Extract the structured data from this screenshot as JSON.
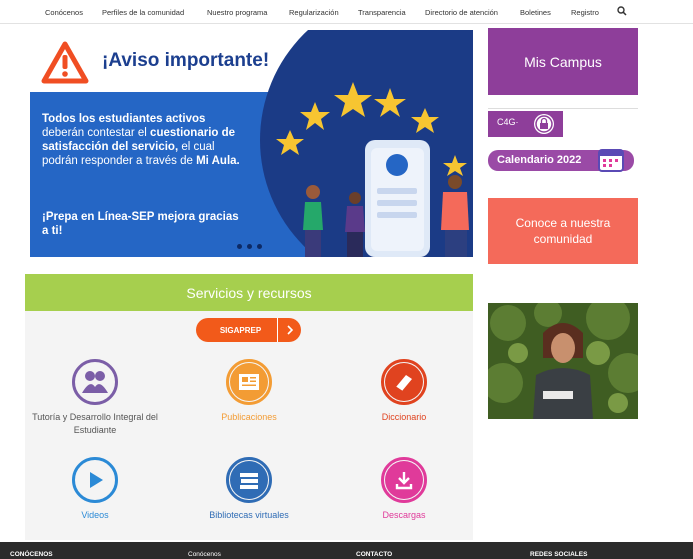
{
  "nav": {
    "items": [
      {
        "label": "Conócenos"
      },
      {
        "label": "Perfiles de la comunidad"
      },
      {
        "label": "Nuestro programa"
      },
      {
        "label": "Regularización"
      },
      {
        "label": "Transparencia"
      },
      {
        "label": "Directorio de atención"
      },
      {
        "label": "Boletines"
      },
      {
        "label": "Registro"
      }
    ],
    "search_icon": "search-icon"
  },
  "hero": {
    "title": "¡Aviso importante!",
    "msg_bold1": "Todos los estudiantes activos",
    "msg_normal1": " deberán contestar el ",
    "msg_bold2": "cuestionario de satisfacción del servicio,",
    "msg_normal2": " el cual podrán responder a través de ",
    "msg_bold3": "Mi Aula.",
    "msg2": "¡Prepa en Línea-SEP mejora gracias a ti!",
    "colors": {
      "dark": "#1c3f8f",
      "blue": "#2566c5",
      "warning": "#f04e23"
    }
  },
  "services": {
    "heading": "Servicios y recursos",
    "sigaprep_label": "SIGAPREP",
    "items": [
      {
        "label": "Tutoría y Desarrollo Integral del Estudiante",
        "icon": "tutoring-icon",
        "color": "#7b5ea7"
      },
      {
        "label": "Publicaciones",
        "icon": "newspaper-icon",
        "color": "#f39c34"
      },
      {
        "label": "Diccionario",
        "icon": "book-icon",
        "color": "#e0431f"
      },
      {
        "label": "Videos",
        "icon": "play-icon",
        "color": "#2b8ad6"
      },
      {
        "label": "Bibliotecas virtuales",
        "icon": "books-stack-icon",
        "color": "#2f6cb5"
      },
      {
        "label": "Descargas",
        "icon": "download-icon",
        "color": "#e03a9a"
      }
    ]
  },
  "sidebar": {
    "mis_campus": "Mis Campus",
    "c4g": "C4G·",
    "calendario": "Calendario 2022",
    "comunidad": "Conoce a nuestra comunidad"
  },
  "footer": {
    "col1": "CONÓCENOS",
    "col2": "Conócenos",
    "col3": "CONTACTO",
    "col4": "REDES SOCIALES"
  }
}
